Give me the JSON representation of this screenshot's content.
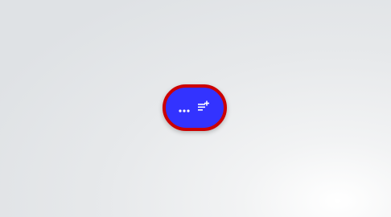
{
  "theme": {
    "pill_fill": "#3333ff",
    "pill_border": "#cc0000",
    "icon_color": "#ffffff"
  },
  "toolbar": {
    "more_button": {
      "icon": "more-horizontal-icon"
    },
    "add_note_button": {
      "icon": "playlist-add-icon"
    }
  }
}
